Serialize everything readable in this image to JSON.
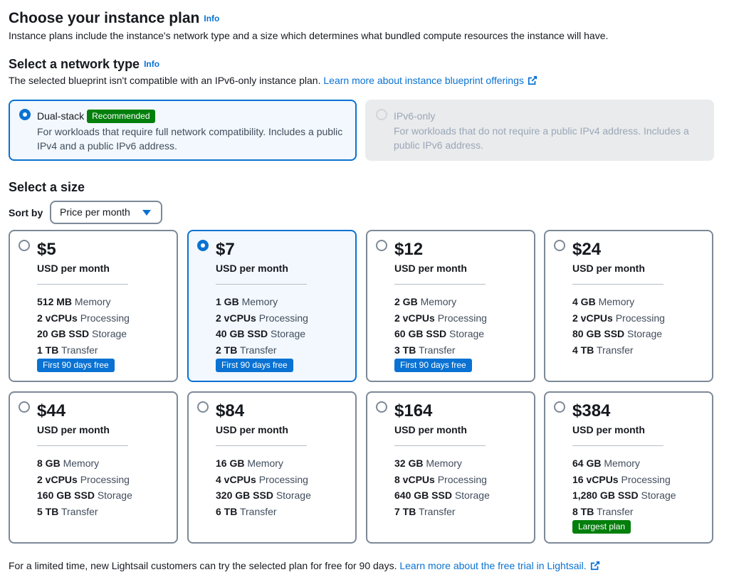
{
  "header": {
    "title": "Choose your instance plan",
    "info": "Info",
    "description": "Instance plans include the instance's network type and a size which determines what bundled compute resources the instance will have."
  },
  "network": {
    "title": "Select a network type",
    "info": "Info",
    "description": "The selected blueprint isn't compatible with an IPv6-only instance plan.",
    "link": "Learn more about instance blueprint offerings",
    "options": [
      {
        "title": "Dual-stack",
        "badge": "Recommended",
        "description": "For workloads that require full network compatibility. Includes a public IPv4 and a public IPv6 address.",
        "selected": true,
        "disabled": false
      },
      {
        "title": "IPv6-only",
        "badge": "",
        "description": "For workloads that do not require a public IPv4 address. Includes a public IPv6 address.",
        "selected": false,
        "disabled": true
      }
    ]
  },
  "size": {
    "title": "Select a size",
    "sort_label": "Sort by",
    "sort_value": "Price per month"
  },
  "plans": [
    {
      "price": "$5",
      "per": "USD per month",
      "memory": "512 MB",
      "memory_label": "Memory",
      "vcpu": "2 vCPUs",
      "vcpu_label": "Processing",
      "storage": "20 GB SSD",
      "storage_label": "Storage",
      "transfer": "1 TB",
      "transfer_label": "Transfer",
      "tag": "First 90 days free",
      "selected": false
    },
    {
      "price": "$7",
      "per": "USD per month",
      "memory": "1 GB",
      "memory_label": "Memory",
      "vcpu": "2 vCPUs",
      "vcpu_label": "Processing",
      "storage": "40 GB SSD",
      "storage_label": "Storage",
      "transfer": "2 TB",
      "transfer_label": "Transfer",
      "tag": "First 90 days free",
      "selected": true
    },
    {
      "price": "$12",
      "per": "USD per month",
      "memory": "2 GB",
      "memory_label": "Memory",
      "vcpu": "2 vCPUs",
      "vcpu_label": "Processing",
      "storage": "60 GB SSD",
      "storage_label": "Storage",
      "transfer": "3 TB",
      "transfer_label": "Transfer",
      "tag": "First 90 days free",
      "selected": false
    },
    {
      "price": "$24",
      "per": "USD per month",
      "memory": "4 GB",
      "memory_label": "Memory",
      "vcpu": "2 vCPUs",
      "vcpu_label": "Processing",
      "storage": "80 GB SSD",
      "storage_label": "Storage",
      "transfer": "4 TB",
      "transfer_label": "Transfer",
      "tag": "",
      "selected": false
    },
    {
      "price": "$44",
      "per": "USD per month",
      "memory": "8 GB",
      "memory_label": "Memory",
      "vcpu": "2 vCPUs",
      "vcpu_label": "Processing",
      "storage": "160 GB SSD",
      "storage_label": "Storage",
      "transfer": "5 TB",
      "transfer_label": "Transfer",
      "tag": "",
      "selected": false
    },
    {
      "price": "$84",
      "per": "USD per month",
      "memory": "16 GB",
      "memory_label": "Memory",
      "vcpu": "4 vCPUs",
      "vcpu_label": "Processing",
      "storage": "320 GB SSD",
      "storage_label": "Storage",
      "transfer": "6 TB",
      "transfer_label": "Transfer",
      "tag": "",
      "selected": false
    },
    {
      "price": "$164",
      "per": "USD per month",
      "memory": "32 GB",
      "memory_label": "Memory",
      "vcpu": "8 vCPUs",
      "vcpu_label": "Processing",
      "storage": "640 GB SSD",
      "storage_label": "Storage",
      "transfer": "7 TB",
      "transfer_label": "Transfer",
      "tag": "",
      "selected": false
    },
    {
      "price": "$384",
      "per": "USD per month",
      "memory": "64 GB",
      "memory_label": "Memory",
      "vcpu": "16 vCPUs",
      "vcpu_label": "Processing",
      "storage": "1,280 GB SSD",
      "storage_label": "Storage",
      "transfer": "8 TB",
      "transfer_label": "Transfer",
      "tag": "Largest plan",
      "selected": false
    }
  ],
  "footer": {
    "text": "For a limited time, new Lightsail customers can try the selected plan for free for 90 days.",
    "link": "Learn more about the free trial in Lightsail."
  },
  "colors": {
    "accent": "#0972d3",
    "success": "#037f0c",
    "selected_bg": "#f2f8fd",
    "border": "#7d8998"
  }
}
